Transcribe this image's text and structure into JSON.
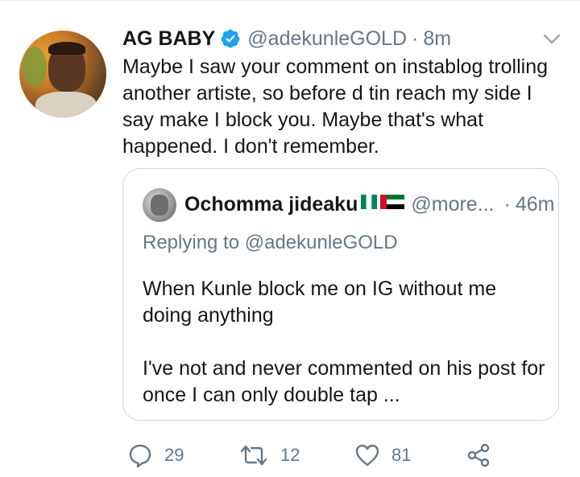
{
  "tweet": {
    "author_name": "AG BABY",
    "author_handle": "@adekunleGOLD",
    "separator": "·",
    "timestamp": "8m",
    "text": "Maybe I saw your comment on instablog trolling another artiste, so before d tin reach my side I say make I block you. Maybe that's what happened. I don't remember."
  },
  "quote": {
    "author_name": "Ochomma jideaku",
    "author_handle": "@more...",
    "separator": "·",
    "timestamp": "46m",
    "replying_to": "Replying to @adekunleGOLD",
    "paragraph_1": "When Kunle block me on IG without me doing anything",
    "paragraph_2": "I've not and  never commented on his post for once I can only double tap ..."
  },
  "actions": {
    "reply_count": "29",
    "retweet_count": "12",
    "like_count": "81"
  },
  "icons": {
    "verified": "verified-badge-icon",
    "menu": "chevron-down-icon",
    "reply": "reply-bubble-icon",
    "retweet": "retweet-icon",
    "like": "heart-icon",
    "share": "share-icon",
    "flags": [
      "nigeria-flag",
      "uae-flag"
    ]
  },
  "colors": {
    "text": "#14171a",
    "secondary": "#657786",
    "verified": "#1da1f2",
    "border": "#ccd6dd"
  }
}
